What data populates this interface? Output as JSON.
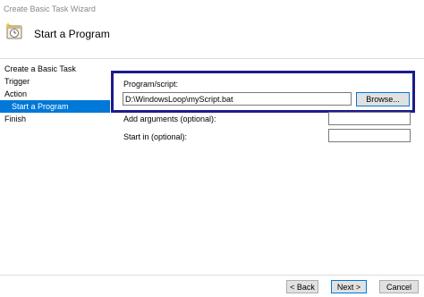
{
  "window": {
    "title": "Create Basic Task Wizard"
  },
  "header": {
    "title": "Start a Program",
    "icon": "task-scheduler-icon"
  },
  "steps": [
    {
      "label": "Create a Basic Task"
    },
    {
      "label": "Trigger"
    },
    {
      "label": "Action"
    },
    {
      "label": "Start a Program",
      "active": true
    },
    {
      "label": "Finish"
    }
  ],
  "program": {
    "label": "Program/script:",
    "value": "D:\\WindowsLoop\\myScript.bat",
    "browse_label": "Browse..."
  },
  "arguments": {
    "label": "Add arguments (optional):",
    "value": ""
  },
  "start_in": {
    "label": "Start in (optional):",
    "value": ""
  },
  "footer": {
    "back_label": "< Back",
    "next_label": "Next >",
    "cancel_label": "Cancel"
  },
  "colors": {
    "accent": "#0078d7",
    "highlight_border": "#1d1b8c"
  }
}
